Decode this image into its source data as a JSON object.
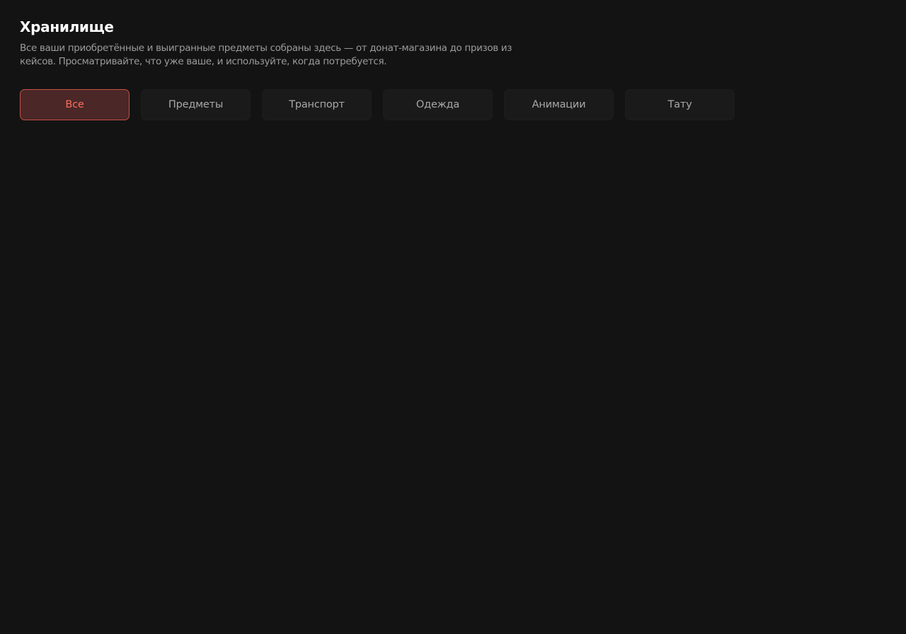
{
  "header": {
    "title": "Хранилище",
    "description": "Все ваши приобретённые и выигранные предметы собраны здесь — от донат-магазина до призов из кейсов. Просматривайте, что уже ваше, и используйте, когда потребуется."
  },
  "tabs": [
    {
      "label": "Все",
      "active": true
    },
    {
      "label": "Предметы",
      "active": false
    },
    {
      "label": "Транспорт",
      "active": false
    },
    {
      "label": "Одежда",
      "active": false
    },
    {
      "label": "Анимации",
      "active": false
    },
    {
      "label": "Тату",
      "active": false
    }
  ],
  "colors": {
    "background": "#131313",
    "accent": "#ff6d5e",
    "accent_border": "#c45248",
    "accent_fill": "#4b2727"
  }
}
